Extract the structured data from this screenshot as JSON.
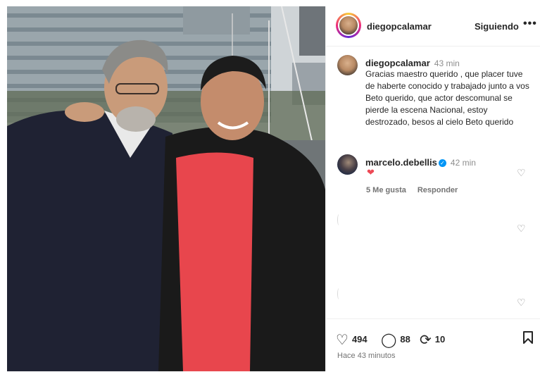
{
  "post": {
    "header": {
      "username": "diegopcalamar",
      "follow_status": "Siguiendo",
      "more_icon": "more-horizontal-icon"
    },
    "caption": {
      "username": "diegopcalamar",
      "time": "43 min",
      "text": "Gracias maestro querido , que placer tuve de haberte conocido y trabajado junto a vos Beto querido, que actor descomunal se pierde la escena Nacional, estoy destrozado, besos al cielo Beto querido"
    },
    "comments": [
      {
        "username": "marcelo.debellis",
        "time": "42 min",
        "text": "❤",
        "likes": "5 Me gusta",
        "reply": "Responder",
        "verified": true
      }
    ],
    "actions": {
      "likes": "494",
      "comments": "88",
      "reposts": "10"
    },
    "posted_ago": "Hace 43 minutos"
  },
  "colors": {
    "text": "#262626",
    "muted": "#737373",
    "heart": "#ed4956",
    "verified": "#0095f6"
  }
}
